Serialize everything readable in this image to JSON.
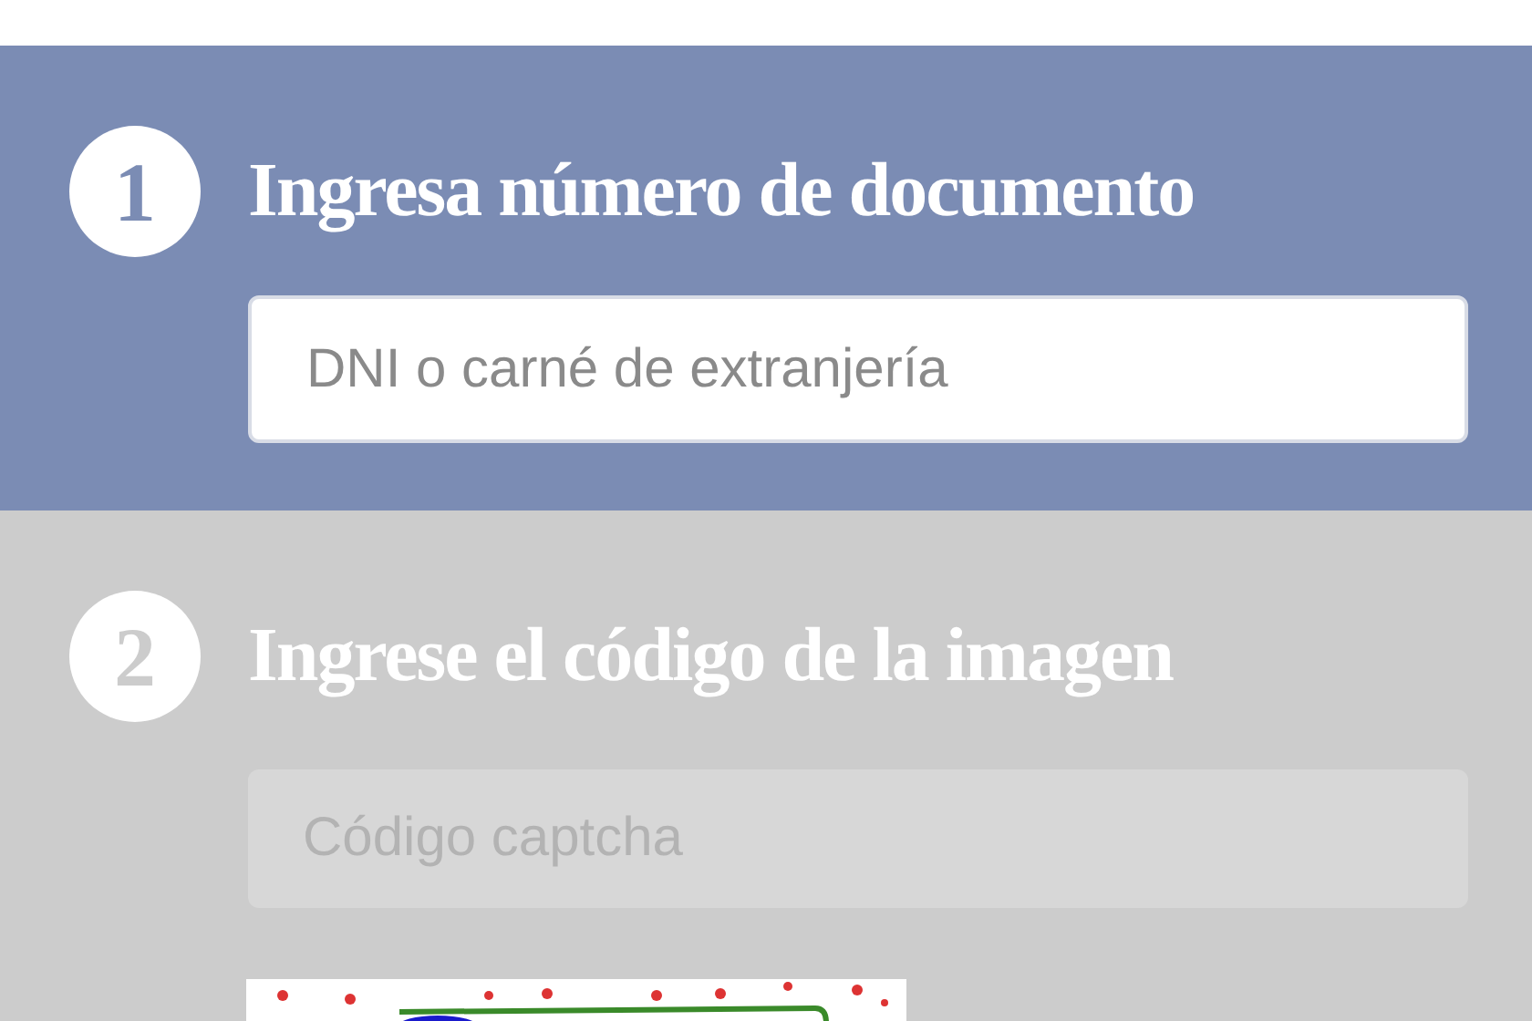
{
  "steps": [
    {
      "number": "1",
      "title": "Ingresa número de documento",
      "placeholder": "DNI o carné de extranjería",
      "active": true
    },
    {
      "number": "2",
      "title": "Ingrese el código de la imagen",
      "placeholder": "Código captcha",
      "active": false
    }
  ]
}
